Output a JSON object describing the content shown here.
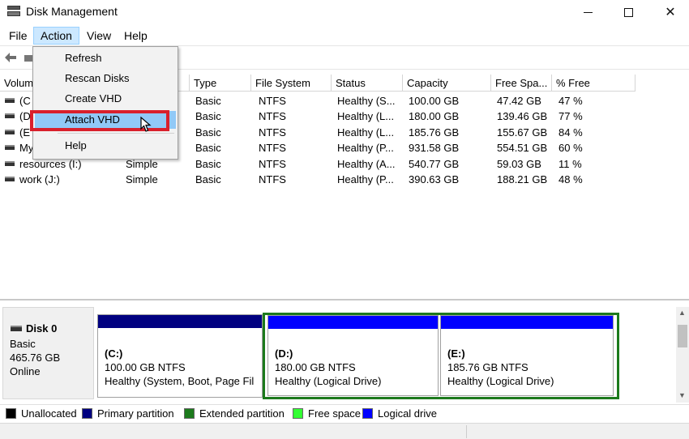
{
  "window": {
    "title": "Disk Management"
  },
  "menubar": {
    "file": "File",
    "action": "Action",
    "view": "View",
    "help": "Help"
  },
  "action_menu": {
    "items": [
      "Refresh",
      "Rescan Disks",
      "Create VHD",
      "Attach VHD",
      "Help"
    ],
    "highlighted": "Attach VHD"
  },
  "volume_list": {
    "columns": [
      "Volum",
      "Type",
      "File System",
      "Status",
      "Capacity",
      "Free Spa...",
      "% Free"
    ],
    "rows": [
      {
        "volume": "(C",
        "layout": "",
        "type": "Basic",
        "fs": "NTFS",
        "status": "Healthy (S...",
        "capacity": "100.00 GB",
        "free": "47.42 GB",
        "pct": "47 %"
      },
      {
        "volume": "(D",
        "layout": "",
        "type": "Basic",
        "fs": "NTFS",
        "status": "Healthy (L...",
        "capacity": "180.00 GB",
        "free": "139.46 GB",
        "pct": "77 %"
      },
      {
        "volume": "(E",
        "layout": "",
        "type": "Basic",
        "fs": "NTFS",
        "status": "Healthy (L...",
        "capacity": "185.76 GB",
        "free": "155.67 GB",
        "pct": "84 %"
      },
      {
        "volume": "My",
        "layout": "",
        "type": "Basic",
        "fs": "NTFS",
        "status": "Healthy (P...",
        "capacity": "931.58 GB",
        "free": "554.51 GB",
        "pct": "60 %"
      },
      {
        "volume": "resources (I:)",
        "layout": "Simple",
        "type": "Basic",
        "fs": "NTFS",
        "status": "Healthy (A...",
        "capacity": "540.77 GB",
        "free": "59.03 GB",
        "pct": "11 %"
      },
      {
        "volume": "work (J:)",
        "layout": "Simple",
        "type": "Basic",
        "fs": "NTFS",
        "status": "Healthy (P...",
        "capacity": "390.63 GB",
        "free": "188.21 GB",
        "pct": "48 %"
      }
    ]
  },
  "disk0": {
    "name": "Disk 0",
    "type": "Basic",
    "size": "465.76 GB",
    "state": "Online",
    "partitions": [
      {
        "name": "(C:)",
        "size": "100.00 GB NTFS",
        "status": "Healthy (System, Boot, Page Fil",
        "color": "#000080"
      },
      {
        "name": "(D:)",
        "size": "180.00 GB NTFS",
        "status": "Healthy (Logical Drive)",
        "color": "#0000ff"
      },
      {
        "name": "(E:)",
        "size": "185.76 GB NTFS",
        "status": "Healthy (Logical Drive)",
        "color": "#0000ff"
      }
    ]
  },
  "legend": [
    {
      "label": "Unallocated",
      "color": "#000000"
    },
    {
      "label": "Primary partition",
      "color": "#000080"
    },
    {
      "label": "Extended partition",
      "color": "#1c7a1c"
    },
    {
      "label": "Free space",
      "color": "#33ff33"
    },
    {
      "label": "Logical drive",
      "color": "#0000ff"
    }
  ],
  "icons": {
    "app": "disk-management-icon",
    "back": "back-arrow-icon",
    "cursor": "mouse-pointer-icon"
  }
}
